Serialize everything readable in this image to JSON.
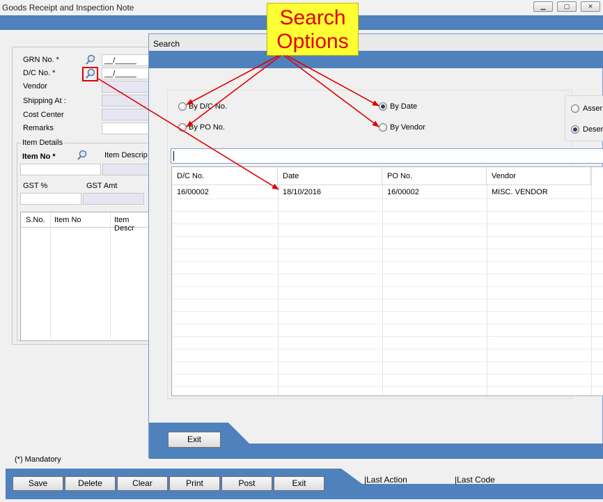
{
  "window": {
    "title": "Goods Receipt and Inspection Note",
    "controls": [
      "▁",
      "▢",
      "✕"
    ]
  },
  "form": {
    "grn_label": "GRN No. *",
    "grn_value": "__/_____",
    "dc_label": "D/C No. *",
    "dc_value": "__/_____",
    "vendor_label": "Vendor",
    "shipping_label": "Shipping At :",
    "cost_center_label": "Cost Center",
    "remarks_label": "Remarks",
    "item_details_label": "Item Details",
    "item_no_label": "Item No *",
    "item_desc_label": "Item Descrip",
    "gst_pct_label": "GST %",
    "gst_amt_label": "GST Amt",
    "grid_headers": [
      "S.No.",
      "Item No",
      "Item Descr"
    ],
    "mandatory_note": "(*) Mandatory"
  },
  "toolbar": {
    "buttons": [
      "Save",
      "Delete",
      "Clear",
      "Print",
      "Post",
      "Exit"
    ],
    "last_action": "|Last Action",
    "last_code": "|Last Code"
  },
  "search_dialog": {
    "title": "Search",
    "options": {
      "by_dc": "By D/C No.",
      "by_po": "By PO No.",
      "by_date": "By Date",
      "by_vendor": "By Vendor",
      "selected": "By Date"
    },
    "sort": {
      "ascending": "Asser",
      "descending": "Deser",
      "selected": "descending"
    },
    "search_value": "",
    "columns": [
      "D/C No.",
      "Date",
      "PO No.",
      "Vendor"
    ],
    "rows": [
      [
        "16/00002",
        "18/10/2016",
        "16/00002",
        "MISC. VENDOR"
      ]
    ],
    "exit_label": "Exit"
  },
  "annotation": {
    "line1": "Search",
    "line2": "Options",
    "color": "#e00000"
  },
  "colors": {
    "band": "#4f81bd",
    "dark_band": "#2f5597"
  }
}
